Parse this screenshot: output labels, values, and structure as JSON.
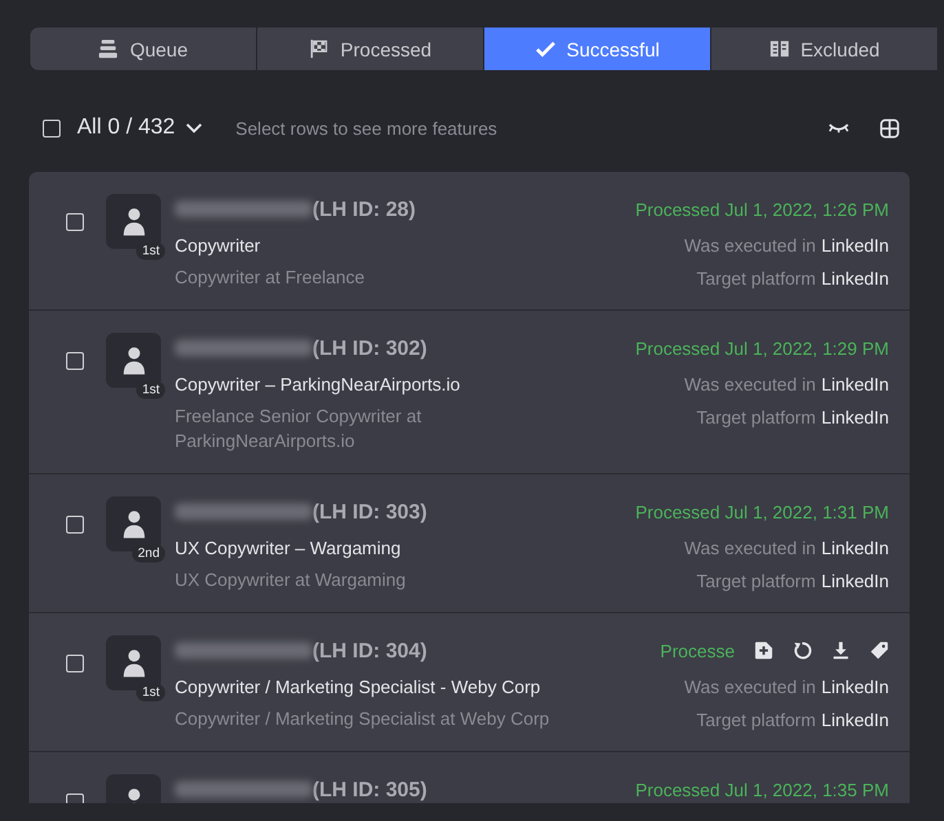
{
  "tabs": [
    {
      "label": "Queue",
      "kind": "queue",
      "selected": false
    },
    {
      "label": "Processed",
      "kind": "processed",
      "selected": false
    },
    {
      "label": "Successful",
      "kind": "successful",
      "selected": true
    },
    {
      "label": "Excluded",
      "kind": "excluded",
      "selected": false
    }
  ],
  "toolbar": {
    "checked": false,
    "count": "All 0 / 432",
    "hint": "Select rows to see more features"
  },
  "rows": [
    {
      "checked": false,
      "lh_id": "(LH ID: 28)",
      "degree": "1st",
      "headline": "Copywriter",
      "position": "Copywriter at Freelance",
      "processed": "Processed Jul 1, 2022, 1:26 PM",
      "executed_label": "Was executed in",
      "executed_value": "LinkedIn",
      "target_label": "Target platform",
      "target_value": "LinkedIn",
      "hovered": false
    },
    {
      "checked": false,
      "lh_id": "(LH ID: 302)",
      "degree": "1st",
      "headline": "Copywriter – ParkingNearAirports.io",
      "position": "Freelance Senior Copywriter at ParkingNearAirports.io",
      "processed": "Processed Jul 1, 2022, 1:29 PM",
      "executed_label": "Was executed in",
      "executed_value": "LinkedIn",
      "target_label": "Target platform",
      "target_value": "LinkedIn",
      "hovered": false
    },
    {
      "checked": false,
      "lh_id": "(LH ID: 303)",
      "degree": "2nd",
      "headline": "UX Copywriter – Wargaming",
      "position": "UX Copywriter at Wargaming",
      "processed": "Processed Jul 1, 2022, 1:31 PM",
      "executed_label": "Was executed in",
      "executed_value": "LinkedIn",
      "target_label": "Target platform",
      "target_value": "LinkedIn",
      "hovered": false
    },
    {
      "checked": false,
      "lh_id": "(LH ID: 304)",
      "degree": "1st",
      "headline": "Copywriter / Marketing Specialist - Weby Corp",
      "position": "Copywriter / Marketing Specialist at Weby Corp",
      "processed": "Processe",
      "executed_label": "Was executed in",
      "executed_value": "LinkedIn",
      "target_label": "Target platform",
      "target_value": "LinkedIn",
      "hovered": true
    },
    {
      "checked": false,
      "lh_id": "(LH ID: 305)",
      "processed": "Processed Jul 1, 2022, 1:35 PM",
      "hovered": false
    }
  ]
}
